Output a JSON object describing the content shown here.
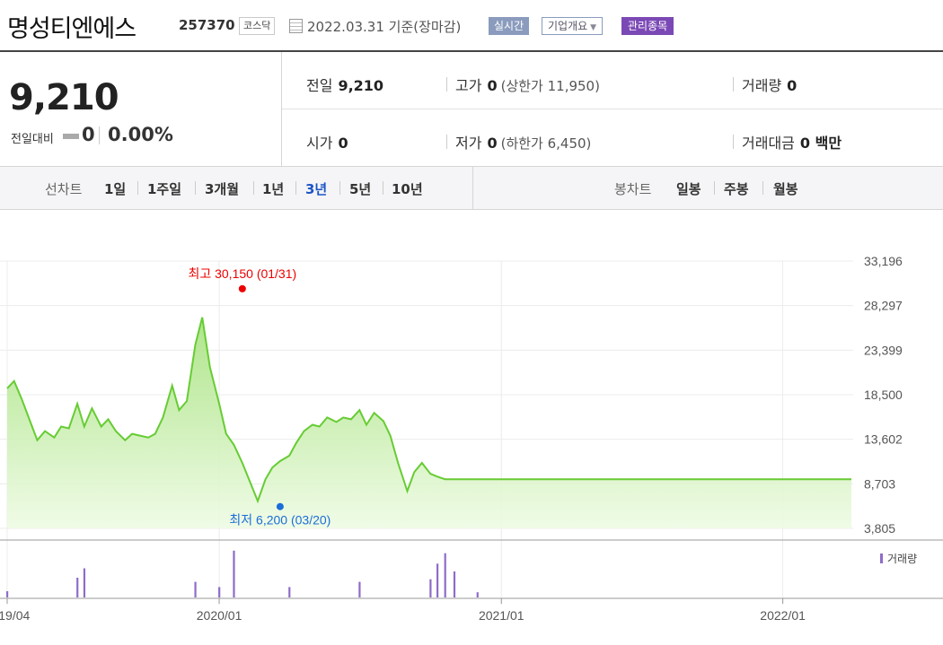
{
  "header": {
    "name": "명성티엔에스",
    "code": "257370",
    "market": "코스닥",
    "date_text": "2022.03.31  기준(장마감)",
    "btn_realtime": "실시간",
    "btn_overview": "기업개요",
    "badge_managed": "관리종목"
  },
  "quote": {
    "price": "9,210",
    "change_label": "전일대비",
    "change": "0",
    "change_pct": "0.00%",
    "prev_label": "전일",
    "prev": "9,210",
    "high_label": "고가",
    "high": "0",
    "upper_limit": "(상한가 11,950)",
    "volume_label": "거래량",
    "volume": "0",
    "open_label": "시가",
    "open": "0",
    "low_label": "저가",
    "low": "0",
    "lower_limit": "(하한가 6,450)",
    "amount_label": "거래대금",
    "amount": "0 백만"
  },
  "periods": {
    "line_label": "선차트",
    "line_items": [
      "1일",
      "1주일",
      "3개월",
      "1년",
      "3년",
      "5년",
      "10년"
    ],
    "selected": "3년",
    "candle_label": "봉차트",
    "candle_items": [
      "일봉",
      "주봉",
      "월봉"
    ]
  },
  "colors": {
    "accent": "#1b55c6",
    "line": "#66cc33",
    "volume": "#8e6cc9",
    "high": "#ee0000",
    "low": "#1a6ed8"
  },
  "chart_data": {
    "type": "area",
    "y_ticks": [
      "33,196",
      "28,297",
      "23,399",
      "18,500",
      "13,602",
      "8,703",
      "3,805"
    ],
    "ylim": [
      3805,
      33196
    ],
    "x_ticks": [
      "2019/04",
      "2020/01",
      "2021/01",
      "2022/01"
    ],
    "x_tick_dates": [
      "2019-04-01",
      "2020-01-01",
      "2021-01-01",
      "2022-01-01"
    ],
    "xlim": [
      "2019-04-01",
      "2022-03-31"
    ],
    "grid": true,
    "series": [
      {
        "x": [
          "2019-04-01",
          "2019-04-10",
          "2019-04-20",
          "2019-05-01",
          "2019-05-10",
          "2019-05-20",
          "2019-06-01",
          "2019-06-10",
          "2019-06-20",
          "2019-07-01",
          "2019-07-10",
          "2019-07-20",
          "2019-08-01",
          "2019-08-10",
          "2019-08-20",
          "2019-09-01",
          "2019-09-10",
          "2019-09-20",
          "2019-10-01",
          "2019-10-10",
          "2019-10-20",
          "2019-11-01",
          "2019-11-10",
          "2019-11-20",
          "2019-12-01",
          "2019-12-10",
          "2019-12-20",
          "2020-01-01",
          "2020-01-10",
          "2020-01-20",
          "2020-01-31",
          "2020-02-10",
          "2020-02-20",
          "2020-03-01",
          "2020-03-10",
          "2020-03-20",
          "2020-04-01",
          "2020-04-10",
          "2020-04-20",
          "2020-05-01",
          "2020-05-10",
          "2020-05-20",
          "2020-06-01",
          "2020-06-10",
          "2020-06-20",
          "2020-07-01",
          "2020-07-10",
          "2020-07-20",
          "2020-08-01",
          "2020-08-10",
          "2020-08-20",
          "2020-09-01",
          "2020-09-10",
          "2020-09-20",
          "2020-10-01",
          "2020-10-10",
          "2020-10-20",
          "2020-11-01",
          "2020-11-10",
          "2020-11-20",
          "2020-12-01",
          "2020-12-10",
          "2022-03-31"
        ],
        "close": [
          19200,
          20000,
          18000,
          15500,
          13500,
          14500,
          13800,
          15000,
          14800,
          17500,
          15000,
          17000,
          15000,
          15800,
          14500,
          13500,
          14200,
          14000,
          13800,
          14200,
          16000,
          19500,
          16800,
          17800,
          24000,
          27000,
          21500,
          17500,
          14200,
          13000,
          11000,
          8900,
          6800,
          9200,
          10500,
          11200,
          11800,
          13200,
          14500,
          15200,
          15000,
          16000,
          15500,
          16000,
          15800,
          16800,
          15200,
          16500,
          15600,
          14000,
          11000,
          7900,
          10000,
          11000,
          9800,
          9500,
          9210,
          9210,
          9210,
          9210,
          9210,
          9210,
          9210
        ]
      }
    ],
    "volume_legend": "거래량",
    "volume_x": [
      "2019-04-01",
      "2019-07-01",
      "2019-07-10",
      "2019-12-01",
      "2020-01-01",
      "2020-01-20",
      "2020-04-01",
      "2020-07-01",
      "2020-10-01",
      "2020-10-10",
      "2020-10-20",
      "2020-11-01",
      "2020-12-01"
    ],
    "volume_rel": [
      0.12,
      0.38,
      0.56,
      0.3,
      0.2,
      0.9,
      0.2,
      0.3,
      0.35,
      0.65,
      0.85,
      0.5,
      0.1
    ],
    "annotations": [
      {
        "label": "최고 30,150 (01/31)",
        "x": "2020-01-31",
        "y": 30150,
        "kind": "high"
      },
      {
        "label": "최저 6,200 (03/20)",
        "x": "2020-03-20",
        "y": 6200,
        "kind": "low"
      }
    ]
  }
}
